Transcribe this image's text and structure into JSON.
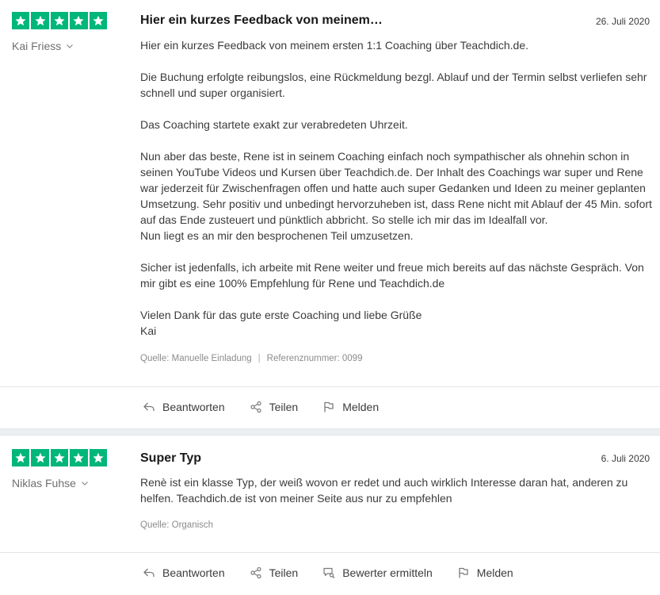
{
  "reviews": [
    {
      "rating": 5,
      "author": "Kai Friess",
      "title": "Hier ein kurzes Feedback von meinem…",
      "date": "26. Juli 2020",
      "body": [
        "Hier ein kurzes Feedback von meinem ersten 1:1 Coaching über Teachdich.de.",
        "Die Buchung erfolgte reibungslos, eine Rückmeldung bezgl. Ablauf und der Termin selbst verliefen sehr schnell und super organisiert.",
        "Das Coaching startete exakt zur verabredeten Uhrzeit.",
        "Nun aber das beste, Rene ist in seinem Coaching einfach noch sympathischer als ohnehin schon in seinen YouTube Videos und Kursen über Teachdich.de. Der Inhalt des Coachings war super und Rene war jederzeit für Zwischenfragen offen und hatte auch super Gedanken und Ideen zu meiner geplanten Umsetzung. Sehr positiv und unbedingt hervorzuheben ist, dass Rene nicht mit Ablauf der 45 Min. sofort auf das Ende zusteuert und pünktlich abbricht. So stelle ich mir das im Idealfall vor.",
        "Nun liegt es an mir den besprochenen Teil umzusetzen.",
        "Sicher ist jedenfalls, ich arbeite mit Rene weiter und freue mich bereits auf das nächste Gespräch. Von mir gibt es eine 100% Empfehlung für Rene und Teachdich.de",
        "Vielen Dank für das gute erste Coaching und liebe Grüße",
        "Kai"
      ],
      "source": "Quelle: Manuelle Einladung",
      "reference": "Referenznummer:  0099",
      "actions": [
        "Beantworten",
        "Teilen",
        "Melden"
      ]
    },
    {
      "rating": 5,
      "author": "Niklas Fuhse",
      "title": "Super Typ",
      "date": "6. Juli 2020",
      "body": [
        "Renè ist ein klasse Typ, der weiß wovon er redet und auch wirklich Interesse daran hat, anderen zu helfen. Teachdich.de ist von meiner Seite aus nur zu empfehlen"
      ],
      "source": "Quelle: Organisch",
      "actions": [
        "Beantworten",
        "Teilen",
        "Bewerter ermitteln",
        "Melden"
      ]
    }
  ],
  "colors": {
    "star_green": "#00b67a",
    "separator": "#eceff2"
  },
  "icons": {
    "star": "star-icon",
    "chevron": "chevron-down-icon",
    "reply": "reply-icon",
    "share": "share-icon",
    "identify": "identify-reviewer-icon",
    "flag": "flag-icon"
  }
}
